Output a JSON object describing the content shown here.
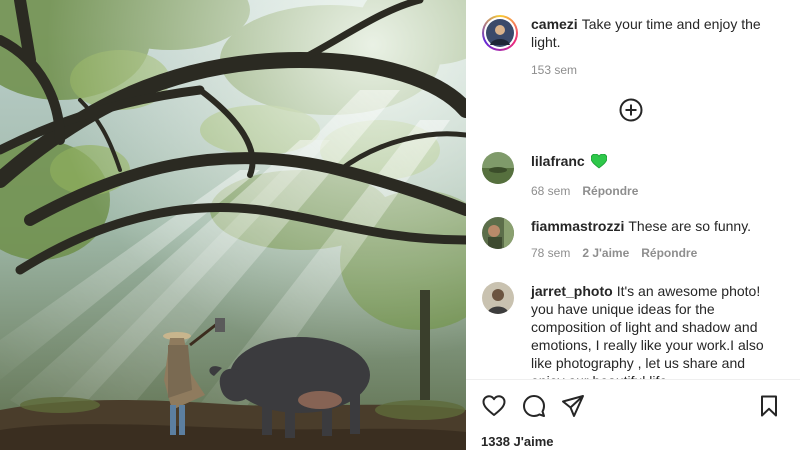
{
  "post": {
    "author": "camezi",
    "caption": "Take your time and enjoy the light.",
    "caption_time": "153 sem",
    "likes": "1338 J'aime"
  },
  "comments": [
    {
      "username": "lilafranc",
      "text": "",
      "emoji": "green-heart",
      "time": "68 sem",
      "likes": "",
      "reply": "Répondre"
    },
    {
      "username": "fiammastrozzi",
      "text": "These are so funny.",
      "time": "78 sem",
      "likes": "2 J'aime",
      "reply": "Répondre"
    },
    {
      "username": "jarret_photo",
      "text": "It's an awesome photo! you have unique ideas for the composition of light and shadow and emotions, I really like your work.I also like photography , let us share and enjoy our beautiful life~"
    }
  ],
  "icons": {
    "load_more": "plus-circle-icon",
    "like": "heart-icon",
    "comment": "comment-icon",
    "share": "send-icon",
    "save": "bookmark-icon"
  },
  "colors": {
    "green_heart": "#2ec84a",
    "meta_gray": "#8e8e8e",
    "text": "#262626"
  }
}
